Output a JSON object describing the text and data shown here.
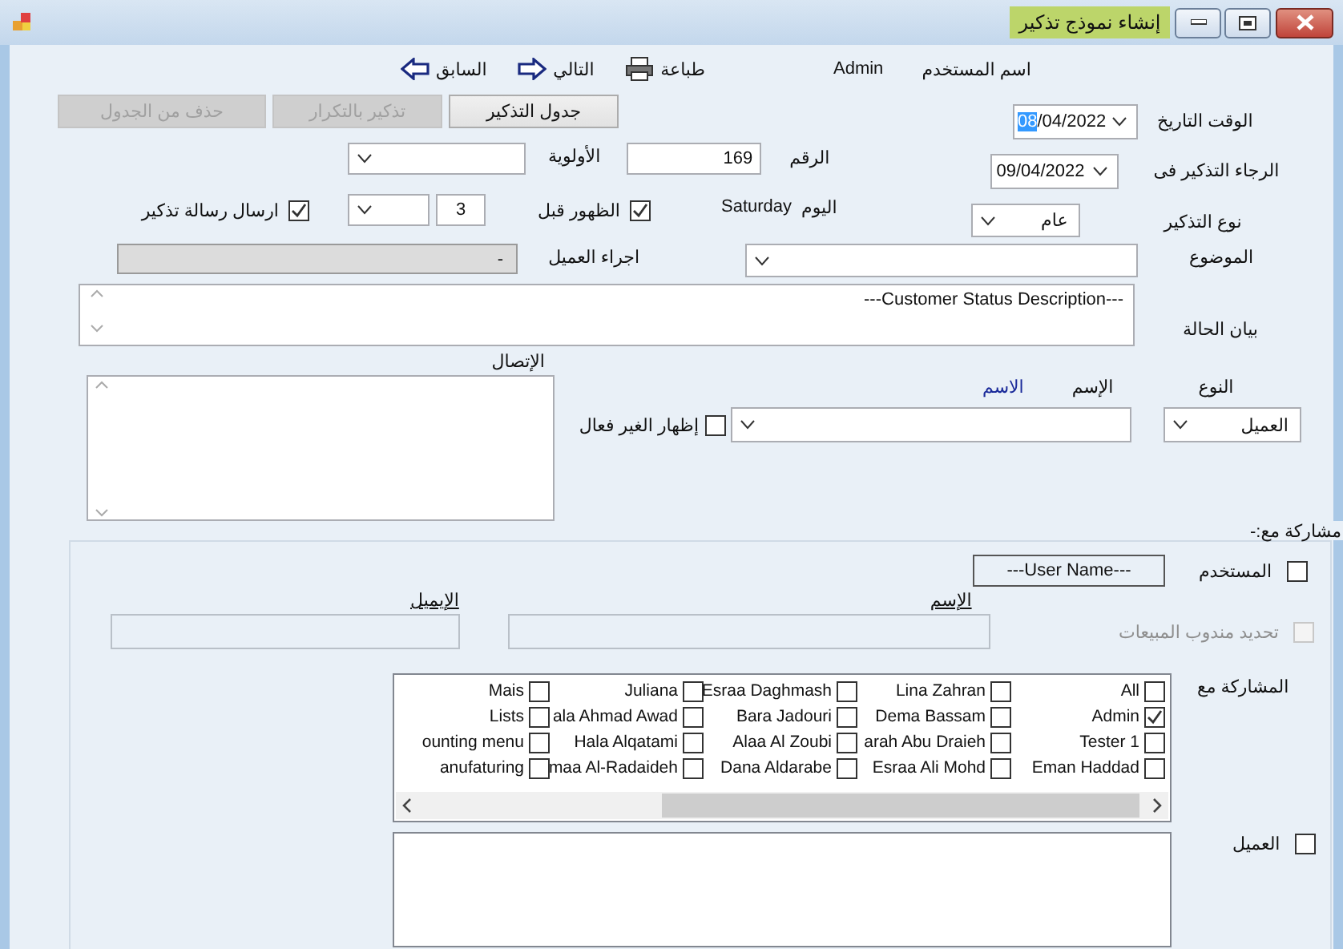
{
  "window": {
    "title": "إنشاء نموذج تذكير"
  },
  "toolbar": {
    "items": [
      {
        "kind": "print",
        "label": "طباعة"
      },
      {
        "kind": "next",
        "label": "التالي"
      },
      {
        "kind": "prev",
        "label": "السابق"
      }
    ],
    "user_value": "Admin",
    "user_label": "اسم المستخدم"
  },
  "buttons": [
    {
      "label": "جدول التذكير",
      "disabled": false
    },
    {
      "label": "تذكير بالتكرار",
      "disabled": true
    },
    {
      "label": "حذف من الجدول",
      "disabled": true
    }
  ],
  "date_time": {
    "label": "الوقت التاريخ",
    "selected_text": "08",
    "rest_text": "/04/2022"
  },
  "priority": {
    "label": "الأولوية"
  },
  "number": {
    "label": "الرقم",
    "value": "169"
  },
  "remind_on": {
    "label": "الرجاء التذكير فى",
    "value": "09/04/2022"
  },
  "send_message": {
    "label": "ارسال رسالة تذكير",
    "checked": true
  },
  "show_before": {
    "label": "الظهور قبل",
    "checked": true,
    "value": "3"
  },
  "day": {
    "label": "اليوم",
    "value": "Saturday"
  },
  "reminder_type": {
    "label": "نوع التذكير",
    "value": "عام"
  },
  "client_action": {
    "label": "اجراء العميل",
    "value": "-",
    "disabled": true
  },
  "subject": {
    "label": "الموضوع"
  },
  "status": {
    "label": "بيان الحالة",
    "value": "---Customer Status Description---"
  },
  "contact": {
    "label": "الإتصال"
  },
  "type": {
    "label": "النوع",
    "value": "العميل"
  },
  "name": {
    "label": "الإسم",
    "value": "الاسم"
  },
  "show_inactive": {
    "label": "إظهار الغير فعال",
    "checked": false
  },
  "share": {
    "title": "مشاركة مع:-",
    "user": {
      "label": "المستخدم",
      "checked": false,
      "value": "---User Name---"
    },
    "name_label": "الإسم",
    "email_label": "الإيميل",
    "sales_rep": {
      "label": "تحديد مندوب المبيعات",
      "checked": false,
      "disabled": true
    },
    "share_with_label": "المشاركة مع",
    "users": [
      {
        "name": "All",
        "checked": false
      },
      {
        "name": "Admin",
        "checked": true
      },
      {
        "name": "Tester 1",
        "checked": false
      },
      {
        "name": "Eman Haddad",
        "checked": false
      },
      {
        "name": "Lina Zahran",
        "checked": false
      },
      {
        "name": "Dema Bassam",
        "checked": false
      },
      {
        "name": "arah Abu Draieh",
        "checked": false
      },
      {
        "name": "Esraa Ali Mohd",
        "checked": false
      },
      {
        "name": "Esraa Daghmash",
        "checked": false
      },
      {
        "name": "Bara Jadouri",
        "checked": false
      },
      {
        "name": "Alaa Al Zoubi",
        "checked": false
      },
      {
        "name": "Dana Aldarabe",
        "checked": false
      },
      {
        "name": "Juliana",
        "checked": false
      },
      {
        "name": "ala Ahmad Awad",
        "checked": false
      },
      {
        "name": "Hala Alqatami",
        "checked": false
      },
      {
        "name": "maa Al-Radaideh",
        "checked": false
      },
      {
        "name": "Mais",
        "checked": false
      },
      {
        "name": "Lists",
        "checked": false
      },
      {
        "name": "ounting menu",
        "checked": false
      },
      {
        "name": "anufaturing",
        "checked": false
      }
    ],
    "customer": {
      "label": "العميل",
      "checked": false
    }
  }
}
